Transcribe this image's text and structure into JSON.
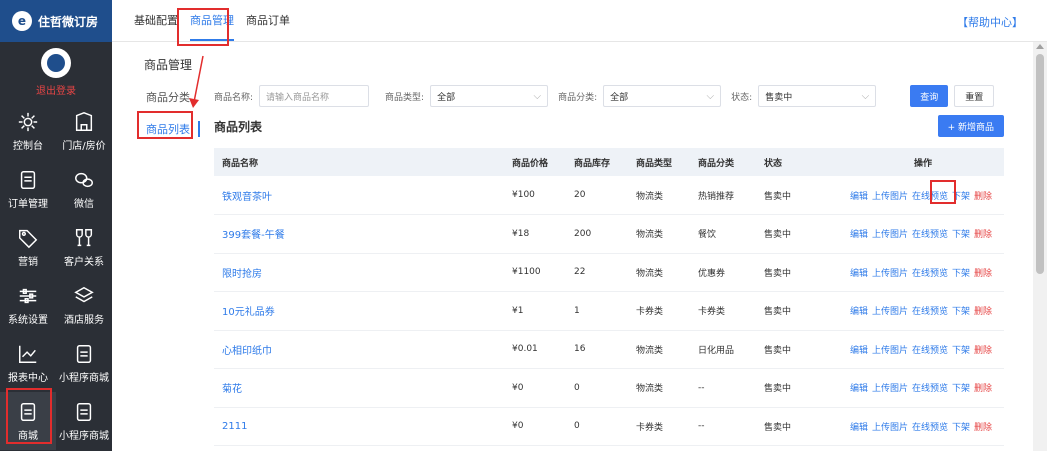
{
  "brand": {
    "name": "住哲微订房"
  },
  "user": {
    "logout_label": "退出登录"
  },
  "sidebar": {
    "items": [
      {
        "label": "控制台",
        "icon": "dashboard-icon"
      },
      {
        "label": "门店/房价",
        "icon": "building-icon"
      },
      {
        "label": "订单管理",
        "icon": "order-icon"
      },
      {
        "label": "微信",
        "icon": "wechat-icon"
      },
      {
        "label": "营销",
        "icon": "tag-icon"
      },
      {
        "label": "客户关系",
        "icon": "glass-icon"
      },
      {
        "label": "系统设置",
        "icon": "sliders-icon"
      },
      {
        "label": "酒店服务",
        "icon": "layers-icon"
      },
      {
        "label": "报表中心",
        "icon": "chart-icon"
      },
      {
        "label": "小程序商城",
        "icon": "document-icon"
      },
      {
        "label": "商城",
        "icon": "document-icon"
      },
      {
        "label": "小程序商城",
        "icon": "document-icon"
      }
    ]
  },
  "topbar": {
    "tabs": [
      {
        "label": "基础配置"
      },
      {
        "label": "商品管理"
      },
      {
        "label": "商品订单"
      }
    ],
    "help_label": "【帮助中心】"
  },
  "subnav": {
    "title": "商品管理",
    "items": [
      {
        "label": "商品分类"
      },
      {
        "label": "商品列表"
      }
    ]
  },
  "filters": {
    "name_label": "商品名称:",
    "name_placeholder": "请输入商品名称",
    "type_label": "商品类型:",
    "type_value": "全部",
    "category_label": "商品分类:",
    "category_value": "全部",
    "status_label": "状态:",
    "status_value": "售卖中",
    "search_label": "查询",
    "reset_label": "重置"
  },
  "list": {
    "title": "商品列表",
    "add_label": "+ 新增商品",
    "columns": [
      "商品名称",
      "商品价格",
      "商品库存",
      "商品类型",
      "商品分类",
      "状态",
      "操作"
    ],
    "actions": {
      "edit": "编辑",
      "upload": "上传图片",
      "preview": "在线预览",
      "offshelf": "下架",
      "delete": "删除"
    },
    "rows": [
      {
        "name": "铁观音茶叶",
        "price": "¥100",
        "stock": "20",
        "type": "物流类",
        "category": "热销推荐",
        "status": "售卖中"
      },
      {
        "name": "399套餐-午餐",
        "price": "¥18",
        "stock": "200",
        "type": "物流类",
        "category": "餐饮",
        "status": "售卖中"
      },
      {
        "name": "限时抢房",
        "price": "¥1100",
        "stock": "22",
        "type": "物流类",
        "category": "优惠券",
        "status": "售卖中"
      },
      {
        "name": "10元礼品券",
        "price": "¥1",
        "stock": "1",
        "type": "卡券类",
        "category": "卡券类",
        "status": "售卖中"
      },
      {
        "name": "心相印纸巾",
        "price": "¥0.01",
        "stock": "16",
        "type": "物流类",
        "category": "日化用品",
        "status": "售卖中"
      },
      {
        "name": "菊花",
        "price": "¥0",
        "stock": "0",
        "type": "物流类",
        "category": "--",
        "status": "售卖中"
      },
      {
        "name": "2111",
        "price": "¥0",
        "stock": "0",
        "type": "卡券类",
        "category": "--",
        "status": "售卖中"
      }
    ]
  }
}
